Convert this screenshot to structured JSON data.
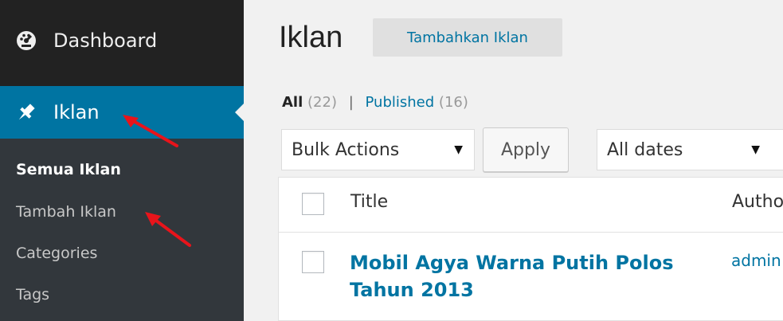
{
  "sidebar": {
    "dashboard_label": "Dashboard",
    "iklan_label": "Iklan",
    "submenu": [
      {
        "label": "Semua Iklan",
        "current": true
      },
      {
        "label": "Tambah Iklan",
        "current": false
      },
      {
        "label": "Categories",
        "current": false
      },
      {
        "label": "Tags",
        "current": false
      }
    ],
    "colors": {
      "bg": "#222222",
      "active": "#0074a2",
      "submenu_bg": "#32373c"
    }
  },
  "main": {
    "title": "Iklan",
    "add_new_label": "Tambahkan Iklan",
    "filters": {
      "all_label": "All",
      "all_count": "(22)",
      "separator": "|",
      "published_label": "Published",
      "published_count": "(16)"
    },
    "bulk_actions": {
      "selected": "Bulk Actions",
      "apply_label": "Apply"
    },
    "date_filter": {
      "selected": "All dates"
    },
    "table": {
      "columns": [
        "Title",
        "Autho"
      ],
      "rows": [
        {
          "title": "Mobil Agya Warna Putih Polos Tahun 2013",
          "author": "admin"
        }
      ]
    }
  },
  "icons": {
    "dashboard": "dashboard-gauge-icon",
    "iklan": "pin-icon",
    "caret": "caret-down-icon",
    "annotation": "red-arrow"
  },
  "accent_color": "#0074a2",
  "arrow_color": "#e8141b"
}
